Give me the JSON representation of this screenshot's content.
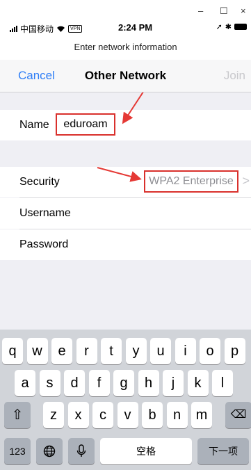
{
  "window": {
    "minimize": "–",
    "maximize": "☐",
    "close": "×"
  },
  "status_bar": {
    "carrier": "中国移动",
    "vpn": "VPN",
    "time": "2:24 PM",
    "icons": [
      "location-icon",
      "bluetooth-icon",
      "battery-icon"
    ]
  },
  "prompt": "Enter network information",
  "nav": {
    "cancel": "Cancel",
    "title": "Other Network",
    "join": "Join"
  },
  "form": {
    "name_label": "Name",
    "name_value": "eduroam",
    "security_label": "Security",
    "security_value": "WPA2 Enterprise",
    "username_label": "Username",
    "password_label": "Password"
  },
  "keyboard": {
    "row1": [
      "q",
      "w",
      "e",
      "r",
      "t",
      "y",
      "u",
      "i",
      "o",
      "p"
    ],
    "row2": [
      "a",
      "s",
      "d",
      "f",
      "g",
      "h",
      "j",
      "k",
      "l"
    ],
    "row3": [
      "z",
      "x",
      "c",
      "v",
      "b",
      "n",
      "m"
    ],
    "numbers": "123",
    "space": "空格",
    "next": "下一项"
  },
  "colors": {
    "accent": "#2f7ef6",
    "highlight": "#d9302c",
    "disabled": "#c8c8cc"
  }
}
